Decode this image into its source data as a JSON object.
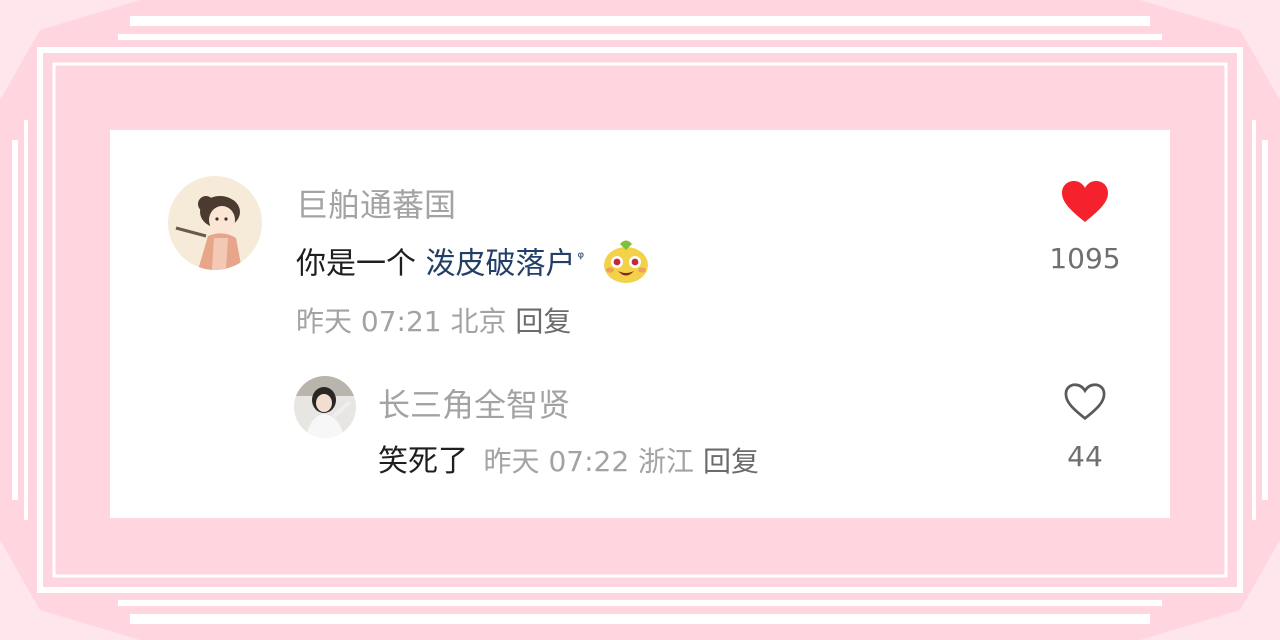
{
  "comment": {
    "username": "巨舶通蕃国",
    "text_prefix": "你是一个 ",
    "link_text": "泼皮破落户",
    "search_mark": "ᵠ",
    "emoji_name": "laughing-face-emoji",
    "timestamp": "昨天 07:21",
    "location": "北京",
    "reply_label": "回复",
    "like_icon": "filled-heart-icon",
    "like_color": "#f5222d",
    "like_count": "1095"
  },
  "reply_comment": {
    "username": "长三角全智贤",
    "text": "笑死了",
    "timestamp": "昨天 07:22",
    "location": "浙江",
    "reply_label": "回复",
    "like_icon": "outline-heart-icon",
    "like_count": "44"
  },
  "colors": {
    "background": "#ffd6e0",
    "card": "#ffffff",
    "username": "#a3a3a3",
    "link": "#223f68"
  }
}
